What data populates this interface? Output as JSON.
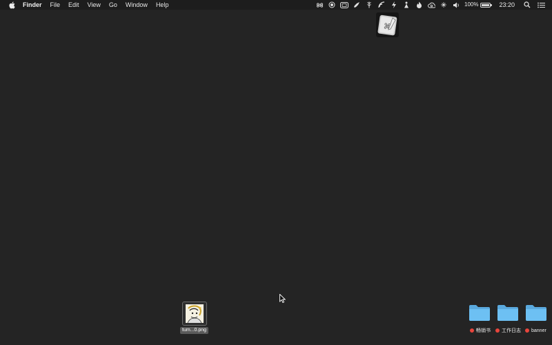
{
  "menubar": {
    "apple_icon": "apple-logo-icon",
    "app_name": "Finder",
    "items": [
      "File",
      "Edit",
      "View",
      "Go",
      "Window",
      "Help"
    ],
    "status_icons": [
      "command-icon",
      "record-icon",
      "display-icon",
      "rocket-icon",
      "tree-icon",
      "wifi-dots-icon",
      "bolt-icon",
      "figure-icon",
      "flame-icon",
      "creative-cloud-icon",
      "network-icon",
      "volume-icon"
    ],
    "battery_text": "100%",
    "battery_level": 1.0,
    "clock": "23:20",
    "right_icons": [
      "search-icon",
      "notification-list-icon"
    ]
  },
  "desktop": {
    "background_color": "#242424",
    "app_icon": "script-editor-icon",
    "file": {
      "label": "tum...0.png"
    },
    "folders": [
      {
        "label": "畅销书",
        "tag_color": "#e8453c"
      },
      {
        "label": "工作日志",
        "tag_color": "#e8453c"
      },
      {
        "label": "banner",
        "tag_color": "#e8453c"
      }
    ]
  }
}
